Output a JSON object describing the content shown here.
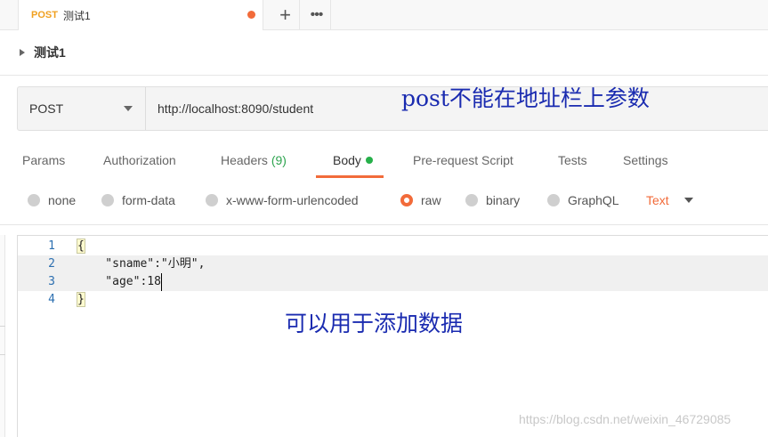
{
  "tab": {
    "method": "POST",
    "name": "测试1"
  },
  "tab_actions": {
    "add_icon": "+",
    "more_icon": "•••"
  },
  "request": {
    "title": "测试1",
    "method": "POST",
    "url": "http://localhost:8090/student"
  },
  "annotations": {
    "top": "post不能在地址栏上参数",
    "bottom": "可以用于添加数据"
  },
  "request_tabs": [
    {
      "label": "Params"
    },
    {
      "label": "Authorization"
    },
    {
      "label": "Headers",
      "count": "(9)"
    },
    {
      "label": "Body"
    },
    {
      "label": "Pre-request Script"
    },
    {
      "label": "Tests"
    },
    {
      "label": "Settings"
    }
  ],
  "body_types": [
    {
      "label": "none",
      "selected": false
    },
    {
      "label": "form-data",
      "selected": false
    },
    {
      "label": "x-www-form-urlencoded",
      "selected": false
    },
    {
      "label": "raw",
      "selected": true
    },
    {
      "label": "binary",
      "selected": false
    },
    {
      "label": "GraphQL",
      "selected": false
    }
  ],
  "raw_format": "Text",
  "editor": {
    "line_numbers": [
      "1",
      "2",
      "3",
      "4"
    ],
    "lines": [
      "{",
      "    \"sname\":\"小明\",",
      "    \"age\":18",
      "}"
    ]
  },
  "watermark": "https://blog.csdn.net/weixin_46729085",
  "colors": {
    "accent": "#f26b3a",
    "method_orange": "#f0a020",
    "annotation_blue": "#1a2bb0",
    "status_green": "#26b04a"
  }
}
